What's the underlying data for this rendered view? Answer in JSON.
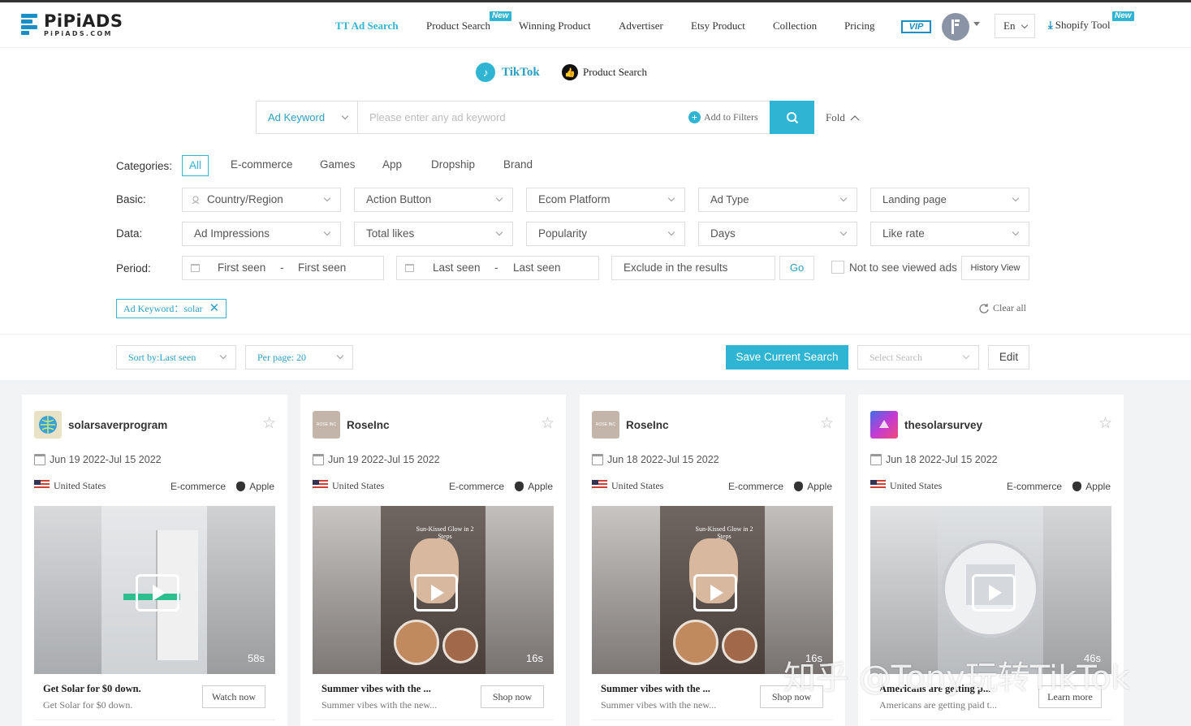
{
  "brand": {
    "name": "PiPiADS",
    "domain": "PiPiADS.COM"
  },
  "nav": {
    "items": [
      {
        "label": "TT Ad Search",
        "active": true
      },
      {
        "label": "Product Search",
        "badge": "New"
      },
      {
        "label": "Winning Product"
      },
      {
        "label": "Advertiser"
      },
      {
        "label": "Etsy Product"
      },
      {
        "label": "Collection"
      },
      {
        "label": "Pricing"
      }
    ],
    "vip": "VIP",
    "language": "En",
    "shopify": "Shopify Tool",
    "shopify_badge": "New"
  },
  "platform_tabs": [
    {
      "label": "TikTok",
      "active": true
    },
    {
      "label": "Product Search"
    }
  ],
  "search": {
    "type": "Ad Keyword",
    "placeholder": "Please enter any ad keyword",
    "add_filters": "Add to Filters",
    "fold": "Fold"
  },
  "filters": {
    "categories_label": "Categories:",
    "categories": [
      "All",
      "E-commerce",
      "Games",
      "App",
      "Dropship",
      "Brand"
    ],
    "basic_label": "Basic:",
    "basic": [
      "Country/Region",
      "Action Button",
      "Ecom Platform",
      "Ad Type",
      "Landing page"
    ],
    "data_label": "Data:",
    "data": [
      "Ad Impressions",
      "Total likes",
      "Popularity",
      "Days",
      "Like rate"
    ],
    "period_label": "Period:",
    "first_seen_from": "First seen",
    "first_seen_to": "First seen",
    "last_seen_from": "Last seen",
    "last_seen_to": "Last seen",
    "dash": "-",
    "exclude_placeholder": "Exclude in the results",
    "go": "Go",
    "not_viewed": "Not to see viewed ads",
    "history_view": "History View"
  },
  "active_tag": "Ad Keyword：solar",
  "clear_all": "Clear all",
  "toolbar": {
    "sort": "Sort by:Last seen",
    "per_page": "Per page:  20",
    "save": "Save Current Search",
    "select_search": "Select Search",
    "edit": "Edit"
  },
  "cards": [
    {
      "advertiser": "solarsaverprogram",
      "dates": "Jun 19 2022-Jul 15 2022",
      "country": "United States",
      "category": "E-commerce",
      "os": "Apple",
      "duration": "58s",
      "title": "Get Solar for $0 down.",
      "subtitle": "Get Solar for $0 down.",
      "cta": "Watch now"
    },
    {
      "advertiser": "RoseInc",
      "dates": "Jun 19 2022-Jul 15 2022",
      "country": "United States",
      "category": "E-commerce",
      "os": "Apple",
      "duration": "16s",
      "overlay": "Sun-Kissed Glow in 2 Steps",
      "title": "Summer vibes with the ...",
      "subtitle": "Summer vibes with the new...",
      "cta": "Shop now"
    },
    {
      "advertiser": "RoseInc",
      "dates": "Jun 18 2022-Jul 15 2022",
      "country": "United States",
      "category": "E-commerce",
      "os": "Apple",
      "duration": "16s",
      "overlay": "Sun-Kissed Glow in 2 Steps",
      "title": "Summer vibes with the ...",
      "subtitle": "Summer vibes with the new...",
      "cta": "Shop now"
    },
    {
      "advertiser": "thesolarsurvey",
      "dates": "Jun 18 2022-Jul 15 2022",
      "country": "United States",
      "category": "E-commerce",
      "os": "Apple",
      "duration": "46s",
      "title": "Americans are getting p...",
      "subtitle": "Americans are getting paid t...",
      "cta": "Learn more"
    }
  ],
  "watermark": "知乎 @Tony玩转TikTok",
  "colors": {
    "accent": "#2fb4d4",
    "brand_blue": "#1a8fc5",
    "page_bg": "#f2f3f5"
  }
}
